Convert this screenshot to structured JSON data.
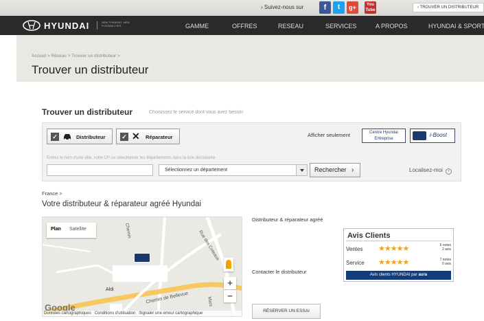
{
  "topbar": {
    "follow_label": "› Suivez-nous sur",
    "social": [
      {
        "icon": "facebook-icon",
        "glyph": "f",
        "color": "#3b5998"
      },
      {
        "icon": "twitter-icon",
        "glyph": "t",
        "color": "#1da1f2"
      },
      {
        "icon": "googleplus-icon",
        "glyph": "g+",
        "color": "#dd4b39"
      },
      {
        "icon": "youtube-icon",
        "glyph": "You Tube",
        "color": "#c4302b"
      }
    ],
    "trouver_label": "› TROUVER UN DISTRIBUTEUR"
  },
  "nav": {
    "logo_name": "HYUNDAI",
    "tagline": "NEW THINKING. NEW POSSIBILITIES.",
    "items": [
      "GAMME",
      "OFFRES",
      "RESEAU",
      "SERVICES",
      "A PROPOS",
      "HYUNDAI & SPORTS"
    ]
  },
  "header": {
    "breadcrumb": "Accueil > Réseau > Trouver un distributeur >",
    "title": "Trouver un distributeur"
  },
  "search": {
    "title": "Trouver un distributeur",
    "subtitle": "Choisissez le service dont vous avez besoin",
    "distributeur_label": "Distributeur",
    "reparateur_label": "Réparateur",
    "afficher_label": "Afficher seulement",
    "centre_label_1": "Centre Hyundai",
    "centre_label_2": "Entreprise",
    "iboost_label": "i-Boost",
    "hint": "Entrez le nom d'une ville, votre CP ou sélectionner les départements dans la liste déroulante",
    "cp_value": "",
    "dept_placeholder": "Sélectionnez un département",
    "search_label": "Rechercher",
    "locate_label": "Localisez-moi"
  },
  "results": {
    "country": "France >",
    "title": "Votre distributeur & réparateur agréé Hyundai"
  },
  "map": {
    "tab_plan": "Plan",
    "tab_satellite": "Satellite",
    "street_1": "Rue des Coteaux",
    "street_2": "Chemin de Bellevue",
    "street_3": "Chemin",
    "street_4": "Mars",
    "place": "Aldi",
    "google": "Google",
    "footer": "Données cartographiques   Conditions d'utilisation   Signaler une erreur cartographique",
    "zoom_in": "+",
    "zoom_out": "−"
  },
  "dealer": {
    "type_label": "Distributeur & réparateur agréé",
    "contact_label": "Contacter le distributeur",
    "reserve_label": "RÉSERVER UN ESSAI"
  },
  "avis": {
    "title": "Avis Clients",
    "rows": [
      {
        "label": "Ventes",
        "stars": "★★★★★",
        "rating": 5,
        "notes": "6 notes",
        "count": "2 avis"
      },
      {
        "label": "Service",
        "stars": "★★★★★",
        "rating": 4.5,
        "notes": "7 notes",
        "count": "0 avis"
      }
    ],
    "footer_text": "Avis clients HYUNDAI par",
    "footer_brand": "aura"
  }
}
